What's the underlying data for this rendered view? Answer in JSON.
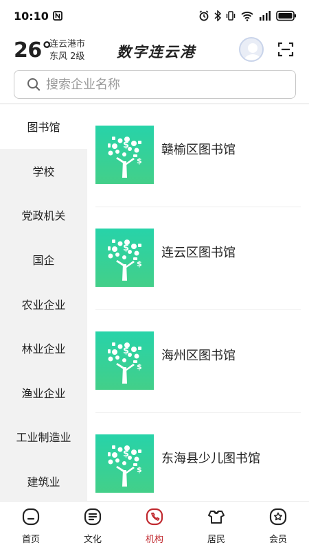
{
  "status_bar": {
    "time": "10:10",
    "battery_icon": "battery-icon"
  },
  "header": {
    "temperature": "26°",
    "city": "连云港市",
    "wind": "东风  2级",
    "title": "数字连云港"
  },
  "search": {
    "placeholder": "搜索企业名称"
  },
  "categories": [
    {
      "label": "图书馆",
      "active": true
    },
    {
      "label": "学校"
    },
    {
      "label": "党政机关"
    },
    {
      "label": "国企"
    },
    {
      "label": "农业企业"
    },
    {
      "label": "林业企业"
    },
    {
      "label": "渔业企业"
    },
    {
      "label": "工业制造业"
    },
    {
      "label": "建筑业"
    }
  ],
  "items": [
    {
      "title": "赣榆区图书馆",
      "icon": "library-tree-icon"
    },
    {
      "title": "连云区图书馆",
      "icon": "library-tree-icon"
    },
    {
      "title": "海州区图书馆",
      "icon": "library-tree-icon"
    },
    {
      "title": "东海县少儿图书馆",
      "icon": "library-tree-icon"
    }
  ],
  "bottom_nav": [
    {
      "label": "首页",
      "icon": "home-icon"
    },
    {
      "label": "文化",
      "icon": "culture-icon"
    },
    {
      "label": "机构",
      "icon": "institution-icon",
      "active": true
    },
    {
      "label": "居民",
      "icon": "resident-icon"
    },
    {
      "label": "会员",
      "icon": "member-icon"
    }
  ],
  "colors": {
    "accent": "#c0282e",
    "thumb_top": "#27d3a9",
    "thumb_bottom": "#43cf89"
  }
}
